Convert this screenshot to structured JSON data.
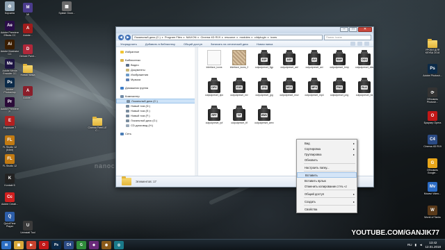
{
  "desktop": {
    "left_icons": [
      {
        "label": "Корзина",
        "icon": "recycle-bin-icon",
        "color": "#8fa3b3",
        "glyph": "♻"
      },
      {
        "label": "Adobe Premiere Effects CC",
        "icon": "after-effects-icon",
        "color": "#2a0d49",
        "glyph": "Ae"
      },
      {
        "label": "Adobe Illustrator CC",
        "icon": "illustrator-icon",
        "color": "#3a1d00",
        "glyph": "Ai"
      },
      {
        "label": "Adobe Media Encoder CC",
        "icon": "media-encoder-icon",
        "color": "#1d1442",
        "glyph": "Me"
      },
      {
        "label": "Adobe Photoshop",
        "icon": "photoshop-icon",
        "color": "#0b2a48",
        "glyph": "Ps"
      },
      {
        "label": "Adobe Premiere P.",
        "icon": "premiere-icon",
        "color": "#2a0b38",
        "glyph": "Pr"
      },
      {
        "label": "Exposure 7",
        "icon": "exposure-icon",
        "color": "#b32020",
        "glyph": "E"
      },
      {
        "label": "FL Studio 12 (64bit)",
        "icon": "fl-studio-icon",
        "color": "#c27a12",
        "glyph": "FL"
      },
      {
        "label": "FL Studio 12",
        "icon": "fl-studio-icon",
        "color": "#c27a12",
        "glyph": "FL"
      },
      {
        "label": "Kontakt 5",
        "icon": "kontakt-icon",
        "color": "#222",
        "glyph": "K"
      },
      {
        "label": "Adobe Creati...",
        "icon": "creative-cloud-icon",
        "color": "#d01f1f",
        "glyph": "Cc"
      },
      {
        "label": "QuickTime Player",
        "icon": "quicktime-icon",
        "color": "#2d5ea8",
        "glyph": "Q"
      }
    ],
    "left2_icons": [
      {
        "label": "Mi",
        "icon": "app-icon",
        "color": "#4a3b8c",
        "glyph": "M"
      },
      {
        "label": "Adobe...",
        "icon": "app-red-icon",
        "color": "#a01c1c",
        "glyph": "A"
      },
      {
        "label": "Deluxe Paint...",
        "icon": "app-red-icon",
        "color": "#b0283a",
        "glyph": "D"
      },
      {
        "label": "Новая папка",
        "icon": "folder-icon",
        "color": "",
        "glyph": ""
      },
      {
        "label": "Adobe...",
        "icon": "app-red-icon",
        "color": "#8a1e2a",
        "glyph": "A"
      },
      {
        "label": "Uninstall Tool",
        "icon": "uninstall-icon",
        "color": "#3a3a3a",
        "glyph": "U"
      }
    ],
    "mid_icons": [
      {
        "label": "Splash Grow...",
        "icon": "image-icon",
        "color": "#6b6b6b",
        "glyph": "▦"
      },
      {
        "label": "Cinema Freel.LE C...",
        "icon": "folder-icon",
        "color": "",
        "glyph": ""
      }
    ],
    "right_icons": [
      {
        "label": "УРОКИ ДЛЯ КЛУБА 2018",
        "icon": "folder-icon",
        "color": "",
        "glyph": ""
      },
      {
        "label": "Adobe Photosh...",
        "icon": "photoshop-icon",
        "color": "#0b2a48",
        "glyph": "Ps"
      },
      {
        "label": "Обновить Photosh...",
        "icon": "update-icon",
        "color": "#333",
        "glyph": "⟳"
      },
      {
        "label": "Браузер Opera",
        "icon": "opera-icon",
        "color": "#c21818",
        "glyph": "O"
      },
      {
        "label": "Cinema 4D R19",
        "icon": "cinema4d-icon",
        "color": "#2a4a84",
        "glyph": "C4"
      },
      {
        "label": "Обновить Google...",
        "icon": "chrome-icon",
        "color": "#e8a61a",
        "glyph": "G"
      },
      {
        "label": "Movavi Video...",
        "icon": "movavi-icon",
        "color": "#2b6bc4",
        "glyph": "Mv"
      },
      {
        "label": "World of Tanks",
        "icon": "game-icon",
        "color": "#5a3a1a",
        "glyph": "W"
      }
    ],
    "watermark": "nanocheme",
    "youtube": "YOUTUBE.COM/GANJIK77"
  },
  "explorer": {
    "title": "",
    "address": [
      "Локальный диск (C:)",
      "Program Files",
      "MAXON",
      "Cinema 4D R19",
      "resource",
      "modules",
      "c4dplugin",
      "icons"
    ],
    "search_placeholder": "Поиск: icons",
    "toolbar": [
      "Упорядочить",
      "Добавить в библиотеку",
      "Общий доступ",
      "Записать на оптический диск",
      "Новая папка"
    ],
    "nav": [
      {
        "label": "Избранное",
        "icon": "star-icon",
        "color": "#f2c531",
        "indent": 0,
        "selected": false
      },
      {
        "label": "Библиотеки",
        "icon": "library-icon",
        "color": "#d9b34d",
        "indent": 0,
        "selected": false,
        "gap": true
      },
      {
        "label": "Видео",
        "icon": "video-icon",
        "color": "#5a6f8a",
        "indent": 1,
        "selected": false
      },
      {
        "label": "Документы",
        "icon": "documents-icon",
        "color": "#c9b577",
        "indent": 1,
        "selected": false
      },
      {
        "label": "Изображения",
        "icon": "pictures-icon",
        "color": "#6c9bc9",
        "indent": 1,
        "selected": false
      },
      {
        "label": "Музыка",
        "icon": "music-icon",
        "color": "#5c7fb3",
        "indent": 1,
        "selected": false
      },
      {
        "label": "Домашняя группа",
        "icon": "homegroup-icon",
        "color": "#3e7ec9",
        "indent": 0,
        "selected": false,
        "gap": true
      },
      {
        "label": "Компьютер",
        "icon": "computer-icon",
        "color": "#6f8aa6",
        "indent": 0,
        "selected": false,
        "gap": true
      },
      {
        "label": "Локальный диск (C:)",
        "icon": "drive-icon",
        "color": "#7a8c9e",
        "indent": 1,
        "selected": true
      },
      {
        "label": "Новый том (D:)",
        "icon": "drive-icon",
        "color": "#7a8c9e",
        "indent": 1,
        "selected": false
      },
      {
        "label": "Новый том (E:)",
        "icon": "drive-icon",
        "color": "#7a8c9e",
        "indent": 1,
        "selected": false
      },
      {
        "label": "Новый том (F:)",
        "icon": "drive-icon",
        "color": "#7a8c9e",
        "indent": 1,
        "selected": false
      },
      {
        "label": "Локальный диск (G:)",
        "icon": "drive-icon",
        "color": "#7a8c9e",
        "indent": 1,
        "selected": false
      },
      {
        "label": "CD-дисковод (H:)",
        "icon": "cd-icon",
        "color": "#9aa9b8",
        "indent": 1,
        "selected": false
      },
      {
        "label": "Сеть",
        "icon": "network-icon",
        "color": "#4a7cb5",
        "indent": 0,
        "selected": false,
        "gap": true
      }
    ],
    "files": [
      {
        "name": "interface_icons",
        "kind": "doc",
        "tag": ""
      },
      {
        "name": "interface_icons_2",
        "kind": "img",
        "tag": ""
      },
      {
        "name": "outputpreset_3gp",
        "kind": "bottle",
        "tag": "3GP"
      },
      {
        "name": "outputpreset_asf",
        "kind": "bottle",
        "tag": "ASF"
      },
      {
        "name": "outputpreset_avi",
        "kind": "bottle",
        "tag": "AVI"
      },
      {
        "name": "outputpreset_bmp",
        "kind": "bottle",
        "tag": "BMP"
      },
      {
        "name": "outputpreset_dds",
        "kind": "bottle",
        "tag": "DDS"
      },
      {
        "name": "outputpreset_dpx",
        "kind": "bottle",
        "tag": "DPX"
      },
      {
        "name": "outputpreset_exr",
        "kind": "bottle",
        "tag": "EXR"
      },
      {
        "name": "outputpreset_jpg",
        "kind": "bottle",
        "tag": "JPG"
      },
      {
        "name": "outputpreset_mov",
        "kind": "bottle",
        "tag": "MOV"
      },
      {
        "name": "outputpreset_mp4",
        "kind": "bottle",
        "tag": "MP4"
      },
      {
        "name": "outputpreset_png",
        "kind": "bottle",
        "tag": "PNG"
      },
      {
        "name": "outputpreset_rla",
        "kind": "bottle",
        "tag": "RLA"
      },
      {
        "name": "outputpreset_rpf",
        "kind": "bottle",
        "tag": "RPF"
      },
      {
        "name": "outputpreset_tif",
        "kind": "bottle",
        "tag": "TIF"
      },
      {
        "name": "outputpreset_wmv",
        "kind": "bottle",
        "tag": "WMV"
      }
    ],
    "status": "Элементов: 17"
  },
  "context_menu": [
    {
      "label": "Вид",
      "arrow": true
    },
    {
      "label": "Сортировка",
      "arrow": true
    },
    {
      "label": "Группировка",
      "arrow": true
    },
    {
      "label": "Обновить"
    },
    {
      "sep": true
    },
    {
      "label": "Настроить папку..."
    },
    {
      "sep": true
    },
    {
      "label": "Вставить",
      "highlight": true
    },
    {
      "label": "Вставить ярлык"
    },
    {
      "label": "Отменить копирование",
      "key": "CTRL+Z"
    },
    {
      "sep": true
    },
    {
      "label": "Общий доступ",
      "arrow": true
    },
    {
      "sep": true
    },
    {
      "label": "Создать",
      "arrow": true
    },
    {
      "sep": true
    },
    {
      "label": "Свойства"
    }
  ],
  "taskbar": {
    "apps": [
      {
        "icon": "start-icon",
        "color": "#2d6fc4",
        "glyph": "⊞"
      },
      {
        "icon": "explorer-icon",
        "color": "#d9a93a",
        "glyph": "▣"
      },
      {
        "icon": "media-icon",
        "color": "#c7432e",
        "glyph": "▶"
      },
      {
        "icon": "opera-icon",
        "color": "#c21818",
        "glyph": "O"
      },
      {
        "icon": "photoshop-icon",
        "color": "#0b2a48",
        "glyph": "Ps"
      },
      {
        "icon": "cinema4d-icon",
        "color": "#2a4a84",
        "glyph": "C4"
      },
      {
        "icon": "chrome-icon",
        "color": "#2f8c3a",
        "glyph": "G"
      },
      {
        "icon": "app-icon",
        "color": "#6a2a7a",
        "glyph": "◆"
      },
      {
        "icon": "app-icon",
        "color": "#8a5a1a",
        "glyph": "◉"
      },
      {
        "icon": "app-icon",
        "color": "#1a7a8a",
        "glyph": "◎"
      }
    ],
    "lang": "RU",
    "time": "13:42",
    "date": "12.01.2018"
  }
}
